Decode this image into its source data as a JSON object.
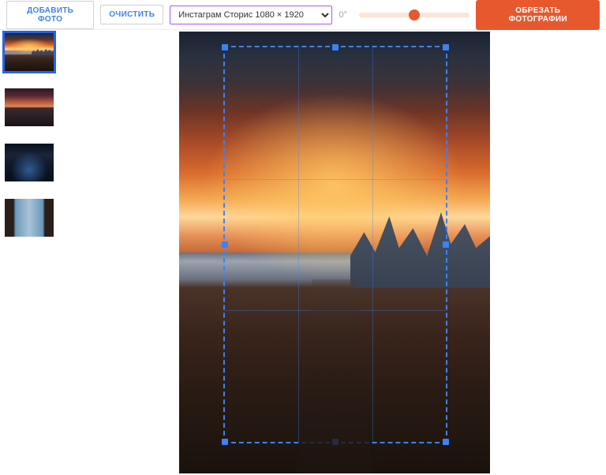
{
  "toolbar": {
    "add_photo_label": "ДОБАВИТЬ ФОТО",
    "clear_label": "ОЧИСТИТЬ",
    "preset_selected": "Инстаграм Сторис 1080 × 1920",
    "rotation_label": "0°",
    "crop_label": "ОБРЕЗАТЬ ФОТОГРАФИИ"
  },
  "rotation": {
    "value": 0,
    "min": -180,
    "max": 180
  },
  "crop": {
    "preset_width": 1080,
    "preset_height": 1920
  },
  "thumbnails": [
    {
      "name": "sunset-skyline",
      "selected": true
    },
    {
      "name": "street-dusk",
      "selected": false
    },
    {
      "name": "night-city-blue",
      "selected": false
    },
    {
      "name": "bridge-arch",
      "selected": false
    }
  ]
}
